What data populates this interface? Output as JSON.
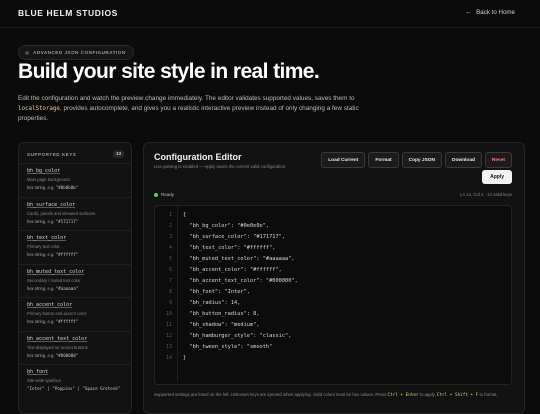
{
  "header": {
    "brand": "BLUE HELM STUDIOS",
    "back_label": "Back to Home"
  },
  "hero": {
    "badge": "ADVANCED JSON CONFIGURATION",
    "title": "Build your site style in real time.",
    "lead_before": "Edit the configuration and watch the preview change immediately. The editor validates supported values, saves them to ",
    "lead_code": "localStorage",
    "lead_after": ", provides autocomplete, and gives you a realistic interactive preview instead of only changing a few static properties."
  },
  "sidebar": {
    "heading": "SUPPORTED KEYS",
    "count": "13",
    "items": [
      {
        "key": "bh_bg_color",
        "desc": "Main page background.",
        "type_label": "hex string, e.g. ",
        "example": "\"#0b0b0b\""
      },
      {
        "key": "bh_surface_color",
        "desc": "Cards, panels and elevated surfaces.",
        "type_label": "hex string, e.g. ",
        "example": "\"#171717\""
      },
      {
        "key": "bh_text_color",
        "desc": "Primary text color.",
        "type_label": "hex string, e.g. ",
        "example": "\"#ffffff\""
      },
      {
        "key": "bh_muted_text_color",
        "desc": "Secondary / muted text color.",
        "type_label": "hex string, e.g. ",
        "example": "\"#aaaaaa\""
      },
      {
        "key": "bh_accent_color",
        "desc": "Primary button and accent color.",
        "type_label": "hex string, e.g. ",
        "example": "\"#ffffff\""
      },
      {
        "key": "bh_accent_text_color",
        "desc": "Text displayed on accent buttons.",
        "type_label": "hex string, e.g. ",
        "example": "\"#000000\""
      },
      {
        "key": "bh_font",
        "desc": "Site-wide typeface.",
        "type_label": "",
        "example": "\"Inter\" | \"Poppins\" | \"Space Grotesk\""
      }
    ]
  },
  "editor": {
    "title": "Configuration Editor",
    "subtitle": "Live parsing is enabled — Apply saves the current valid configuration.",
    "buttons": {
      "load": "Load Current",
      "format": "Format",
      "copy": "Copy JSON",
      "download": "Download",
      "reset": "Reset",
      "apply": "Apply"
    },
    "status": "Ready",
    "meta": "Ln 14, Col 2 · 13 valid keys",
    "lines": [
      "{",
      "  \"bh_bg_color\": \"#0e0e0e\",",
      "  \"bh_surface_color\": \"#171717\",",
      "  \"bh_text_color\": \"#ffffff\",",
      "  \"bh_muted_text_color\": \"#aaaaaa\",",
      "  \"bh_accent_color\": \"#ffffff\",",
      "  \"bh_accent_text_color\": \"#000000\",",
      "  \"bh_font\": \"Inter\",",
      "  \"bh_radius\": 14,",
      "  \"bh_button_radius\": 8,",
      "  \"bh_shadow\": \"medium\",",
      "  \"bh_hamburger_style\": \"classic\",",
      "  \"bh_tween_style\": \"smooth\"",
      "}"
    ],
    "line_numbers": [
      "1",
      "2",
      "3",
      "4",
      "5",
      "6",
      "7",
      "8",
      "9",
      "10",
      "11",
      "12",
      "13",
      "14"
    ],
    "footer_before": "Supported settings are listed on the left. Unknown keys are ignored when applying. Valid colors must be hex values. Press ",
    "footer_kbd1": "Ctrl + Enter",
    "footer_mid": " to apply, ",
    "footer_kbd2": "Ctrl + Shift + F",
    "footer_after": " to format."
  }
}
